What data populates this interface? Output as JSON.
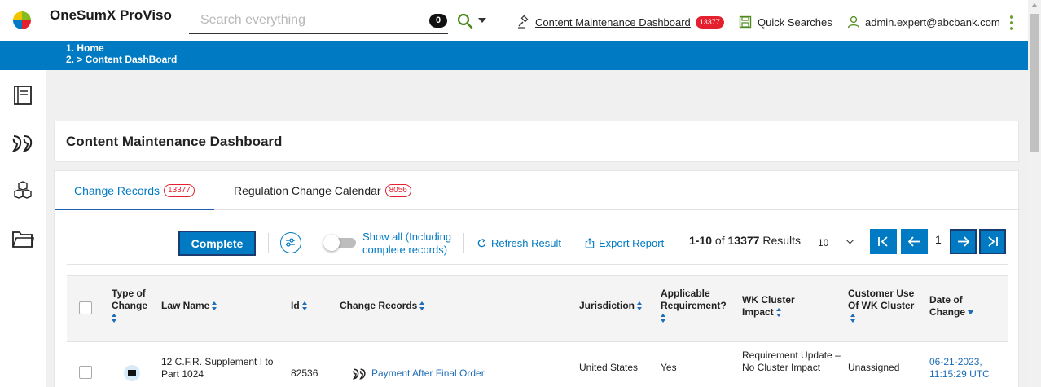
{
  "app": {
    "title": "OneSumX ProViso"
  },
  "search": {
    "placeholder": "Search everything",
    "count": "0"
  },
  "header": {
    "dashboard_link": "Content Maintenance Dashboard",
    "dashboard_badge": "13377",
    "quick_searches": "Quick Searches",
    "user_email": "admin.expert@abcbank.com"
  },
  "breadcrumb": {
    "item1": "1.  Home",
    "item2": "2.   >  Content DashBoard"
  },
  "sidebar": {
    "icons": [
      "notebook-icon",
      "quote-icon",
      "cubes-icon",
      "folder-icon"
    ]
  },
  "page": {
    "title": "Content Maintenance Dashboard"
  },
  "tabs": [
    {
      "label": "Change Records",
      "count": "13377",
      "active": true
    },
    {
      "label": "Regulation Change Calendar",
      "count": "8056",
      "active": false
    }
  ],
  "toolbar": {
    "complete_label": "Complete",
    "show_all_label": "Show all (Including complete records)",
    "refresh_label": "Refresh Result",
    "export_label": "Export Report",
    "results_range": "1-10",
    "results_of": "of",
    "results_total": "13377",
    "results_suffix": "Results",
    "page_size": "10",
    "current_page": "1"
  },
  "table": {
    "headers": {
      "type": "Type of Change",
      "law_name": "Law Name",
      "id": "Id",
      "change_records": "Change Records",
      "jurisdiction": "Jurisdiction",
      "applicable": "Applicable Requirement?",
      "wk_cluster": "WK Cluster Impact",
      "customer_use": "Customer Use Of WK Cluster",
      "date": "Date of Change"
    },
    "rows": [
      {
        "law_name": "12 C.F.R. Supplement I to Part 1024",
        "id": "82536",
        "change_record": "Payment After Final Order",
        "jurisdiction": "United States",
        "applicable": "Yes",
        "wk_cluster": "Requirement Update – No Cluster Impact",
        "customer_use": "Unassigned",
        "date": "06-21-2023, 11:15:29 UTC"
      }
    ]
  },
  "colors": {
    "brand_blue": "#007ac3",
    "badge_red": "#e5202e",
    "accent_green": "#6aa12c"
  }
}
